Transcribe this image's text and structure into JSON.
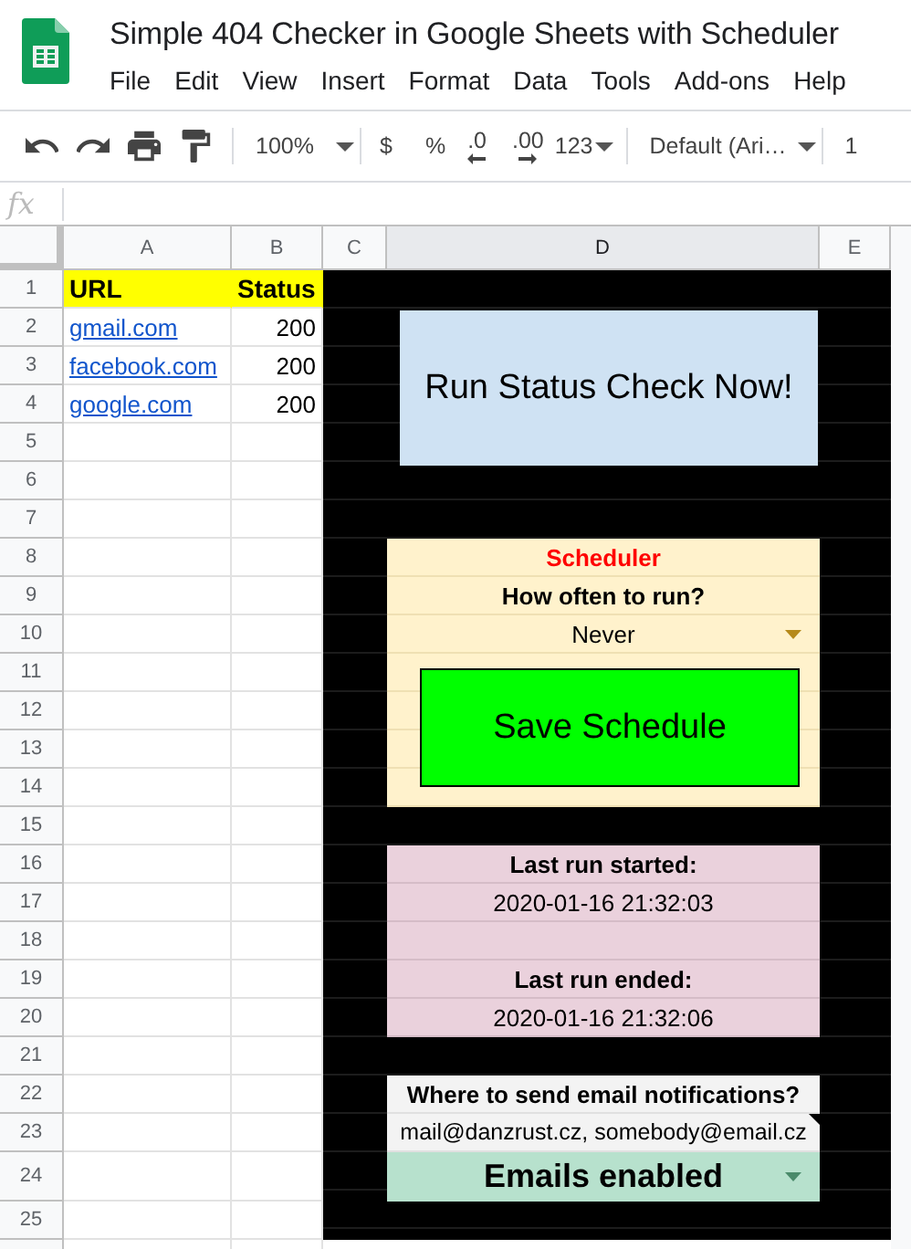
{
  "app": {
    "title": "Simple 404 Checker in Google Sheets with Scheduler"
  },
  "menu": [
    "File",
    "Edit",
    "View",
    "Insert",
    "Format",
    "Data",
    "Tools",
    "Add-ons",
    "Help"
  ],
  "toolbar": {
    "zoom": "100%",
    "currency": "$",
    "percent": "%",
    "decrease_decimal": ".0",
    "increase_decimal": ".00",
    "number_format": "123",
    "font": "Default (Ari…",
    "font_size": "1"
  },
  "formula_bar": {
    "label": "fx"
  },
  "columns": [
    {
      "label": "A",
      "selected": false
    },
    {
      "label": "B",
      "selected": false
    },
    {
      "label": "C",
      "selected": false
    },
    {
      "label": "D",
      "selected": true
    },
    {
      "label": "E",
      "selected": false
    }
  ],
  "row_numbers": [
    "1",
    "2",
    "3",
    "4",
    "5",
    "6",
    "7",
    "8",
    "9",
    "10",
    "11",
    "12",
    "13",
    "14",
    "15",
    "16",
    "17",
    "18",
    "19",
    "20",
    "21",
    "22",
    "23",
    "24",
    "25"
  ],
  "table": {
    "header": [
      "URL",
      "Status"
    ],
    "rows": [
      {
        "url": "gmail.com",
        "status": "200"
      },
      {
        "url": "facebook.com",
        "status": "200"
      },
      {
        "url": "google.com",
        "status": "200"
      }
    ]
  },
  "run_button": "Run Status Check Now!",
  "scheduler": {
    "title": "Scheduler",
    "question": "How often to run?",
    "frequency": "Never",
    "save_button": "Save Schedule"
  },
  "last_run": {
    "started_label": "Last run started:",
    "started": "2020-01-16 21:32:03",
    "ended_label": "Last run ended:",
    "ended": "2020-01-16 21:32:06"
  },
  "notifications": {
    "question": "Where to send email notifications?",
    "recipients": "mail@danzrust.cz, somebody@email.cz",
    "status": "Emails enabled"
  }
}
